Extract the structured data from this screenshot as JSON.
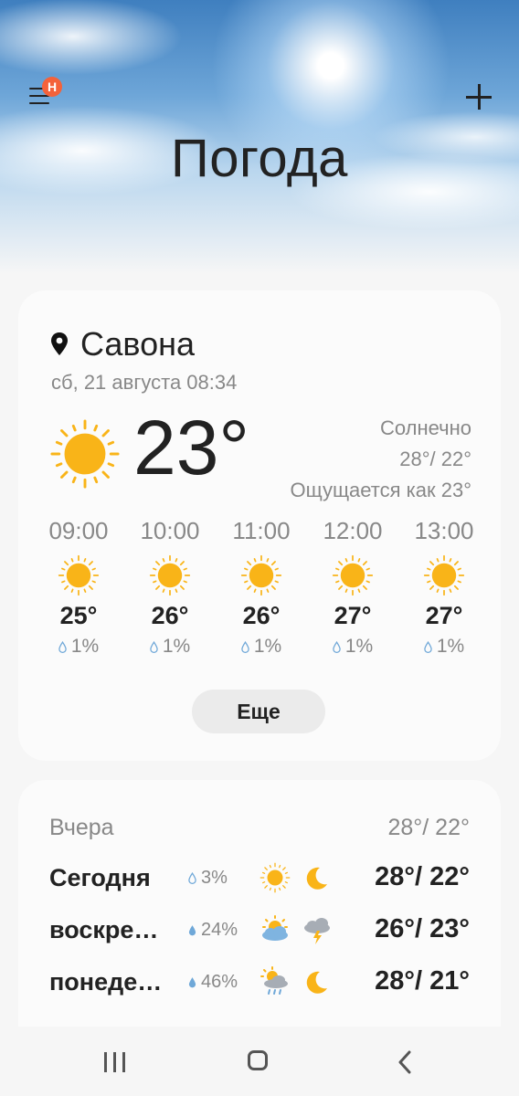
{
  "header": {
    "title": "Погода",
    "menu_icon": "menu-icon",
    "badge": "Н",
    "add_icon": "plus-icon"
  },
  "current": {
    "location_icon": "map-pin-icon",
    "city": "Савона",
    "datetime": "сб, 21 августа 08:34",
    "condition_icon": "sun-icon",
    "temperature": "23°",
    "condition": "Солнечно",
    "high_low": "28°/ 22°",
    "feels_like": "Ощущается как 23°"
  },
  "hourly": [
    {
      "time": "09:00",
      "icon": "sun-icon",
      "temp": "25°",
      "precip": "1%"
    },
    {
      "time": "10:00",
      "icon": "sun-icon",
      "temp": "26°",
      "precip": "1%"
    },
    {
      "time": "11:00",
      "icon": "sun-icon",
      "temp": "26°",
      "precip": "1%"
    },
    {
      "time": "12:00",
      "icon": "sun-icon",
      "temp": "27°",
      "precip": "1%"
    },
    {
      "time": "13:00",
      "icon": "sun-icon",
      "temp": "27°",
      "precip": "1%"
    }
  ],
  "more_button": "Еще",
  "daily": {
    "yesterday_label": "Вчера",
    "yesterday_range": "28°/ 22°",
    "days": [
      {
        "name": "Сегодня",
        "precip": "3%",
        "day_icon": "sun-icon",
        "night_icon": "moon-icon",
        "range": "28°/ 22°"
      },
      {
        "name": "воскре…",
        "precip": "24%",
        "day_icon": "partly-cloudy-icon",
        "night_icon": "thunderstorm-icon",
        "range": "26°/ 23°"
      },
      {
        "name": "понеде…",
        "precip": "46%",
        "day_icon": "sun-rain-icon",
        "night_icon": "moon-icon",
        "range": "28°/ 21°"
      }
    ]
  },
  "colors": {
    "sun": "#f9b418",
    "moon": "#f9b418",
    "drop": "#6fa8d8",
    "badge": "#f4623a"
  },
  "navbar": {
    "recent_icon": "recent-apps-icon",
    "home_icon": "home-icon",
    "back_icon": "back-icon"
  }
}
